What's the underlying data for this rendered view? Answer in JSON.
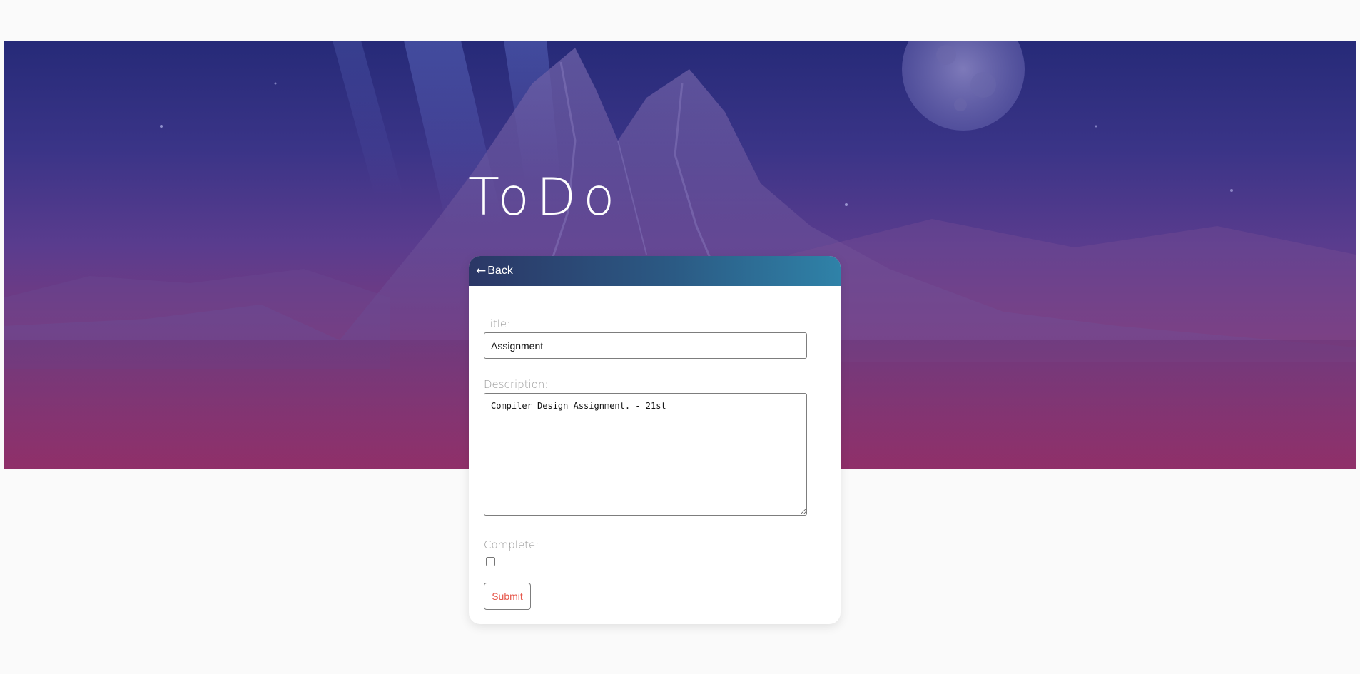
{
  "app": {
    "title": "ToDo"
  },
  "card": {
    "back_arrow": "←",
    "back_label": "Back"
  },
  "form": {
    "title_label": "Title:",
    "title_value": "Assignment",
    "description_label": "Description:",
    "description_value": "Compiler Design Assignment. - 21st",
    "complete_label": "Complete:",
    "complete_checked": false,
    "submit_label": "Submit"
  },
  "colors": {
    "header_gradient_start": "#2b3766",
    "header_gradient_end": "#2f82a8",
    "submit_text": "#e6574b",
    "hero_top": "#262a78",
    "hero_bottom": "#a02a5e"
  }
}
